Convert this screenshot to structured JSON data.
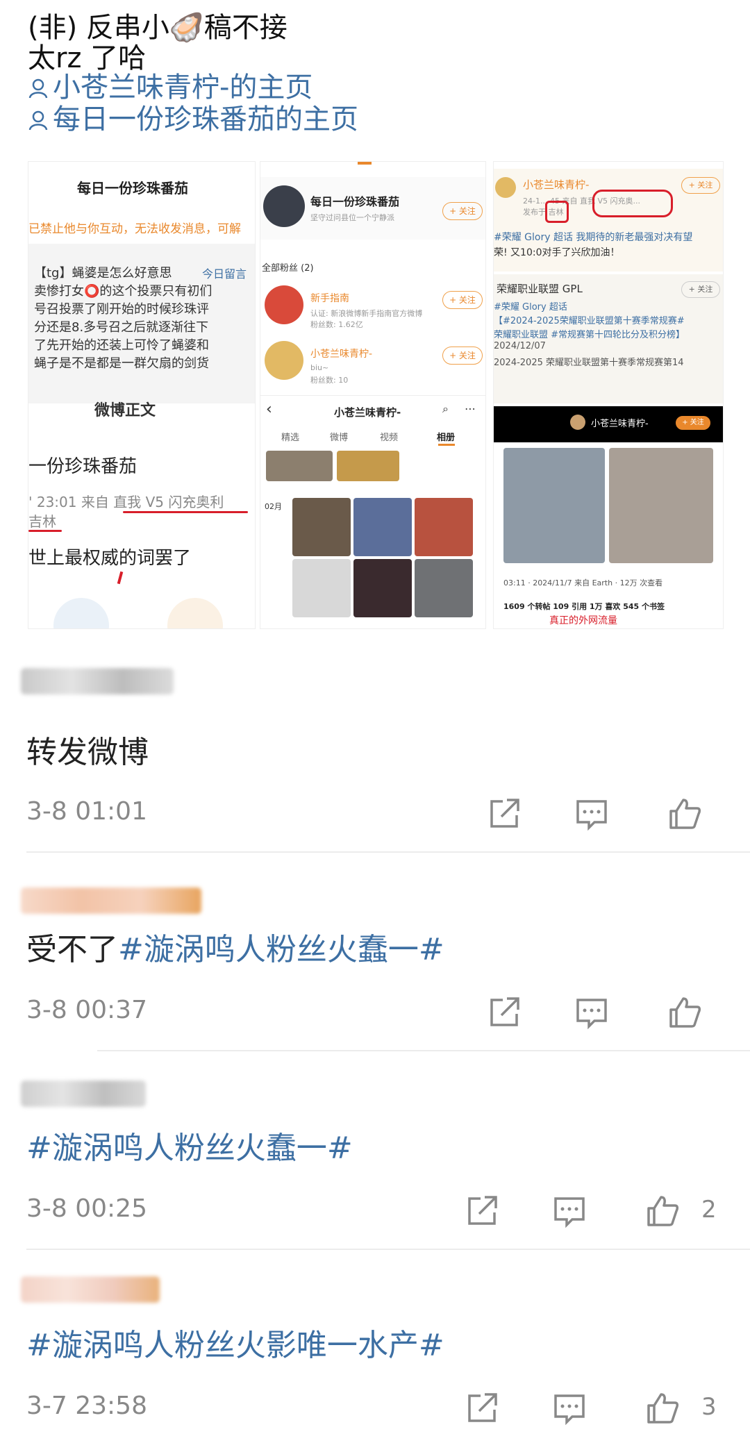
{
  "post": {
    "line1": "(非) 反串小🦪稿不接",
    "line2": "太rz 了哈",
    "link1": "小苍兰味青柠-的主页",
    "link2": "每日一份珍珠番茄的主页"
  },
  "shot1": {
    "title": "每日一份珍珠番茄",
    "blocked": "已禁止他与你互动，无法收发消息，可解",
    "msg_lines": [
      "【tg】蝇婆是怎么好意思",
      "卖惨打女⭕的这个投票只有初们",
      "号召投票了刚开始的时候珍珠评",
      "分还是8.多号召之后就逐渐往下",
      "了先开始的还装上可怜了蝇婆和",
      "蝇子是不是都是一群欠扇的剑货"
    ],
    "msg_tag": "今日留言",
    "cut_title": "微博正文",
    "name": "一份珍珠番茄",
    "meta": "' 23:01 来自 直我 V5 闪充奥利",
    "meta2": "吉林",
    "body": "世上最权威的词罢了"
  },
  "shot2": {
    "name": "每日一份珍珠番茄",
    "sub": "坚守过问县位一个宁静派",
    "follow": "+ 关注",
    "fans_label": "全部粉丝 (2)",
    "fan1_name": "新手指南",
    "fan1_sub1": "认证: 新浪微博新手指南官方微博",
    "fan1_sub2": "粉丝数: 1.62亿",
    "fan2_name": "小苍兰味青柠-",
    "fan2_sub1": "biu~",
    "fan2_sub2": "粉丝数: 10",
    "profile_title": "小苍兰味青柠-",
    "tabs": [
      "精选",
      "微博",
      "视频",
      "相册"
    ],
    "month": "02月"
  },
  "shot3": {
    "name": "小苍兰味青柠-",
    "meta": "24-1... 45 来自 直我 V5 闪充奥...",
    "meta2": "发布于 吉林",
    "follow": "+ 关注",
    "text1": "#荣耀 Glory 超话 我期待的新老最强对决有望",
    "text2": "荣! 又10:0对手了兴欣加油！",
    "org": "荣耀职业联盟 GPL",
    "org_lines": [
      "#荣耀 Glory 超话",
      "【#2024-2025荣耀职业联盟第十赛季常规赛#",
      "荣耀职业联盟 #常规赛第十四轮比分及积分榜】",
      "2024/12/07",
      "2024-2025 荣耀职业联盟第十赛季常规赛第14"
    ],
    "video_user": "小苍兰味青柠-",
    "video_follow": "+ 关注",
    "video_meta": "03:11 · 2024/11/7 来自 Earth · 12万 次查看",
    "stats": "1609 个转帖  109 引用  1万 喜欢  545 个书签",
    "stats_tail": "真正的外网流量"
  },
  "comments": [
    {
      "text": "转发微博",
      "time": "3-8 01:01",
      "likes": ""
    },
    {
      "text_plain": "受不了",
      "text_tag": "#漩涡鸣人粉丝火蠢一#",
      "time": "3-8 00:37",
      "likes": ""
    },
    {
      "text_tag": "#漩涡鸣人粉丝火蠢一#",
      "time": "3-8 00:25",
      "likes": "2"
    },
    {
      "text_tag": "#漩涡鸣人粉丝火影唯一水产#",
      "time": "3-7 23:58",
      "likes": "3"
    }
  ],
  "icons": {
    "share": "share-icon",
    "comment": "comment-icon",
    "like": "like-icon",
    "user": "user-icon"
  },
  "colors": {
    "link": "#3d6fa3",
    "accent": "#e9882c",
    "red_mark": "#d81e2a",
    "time": "#888888"
  }
}
